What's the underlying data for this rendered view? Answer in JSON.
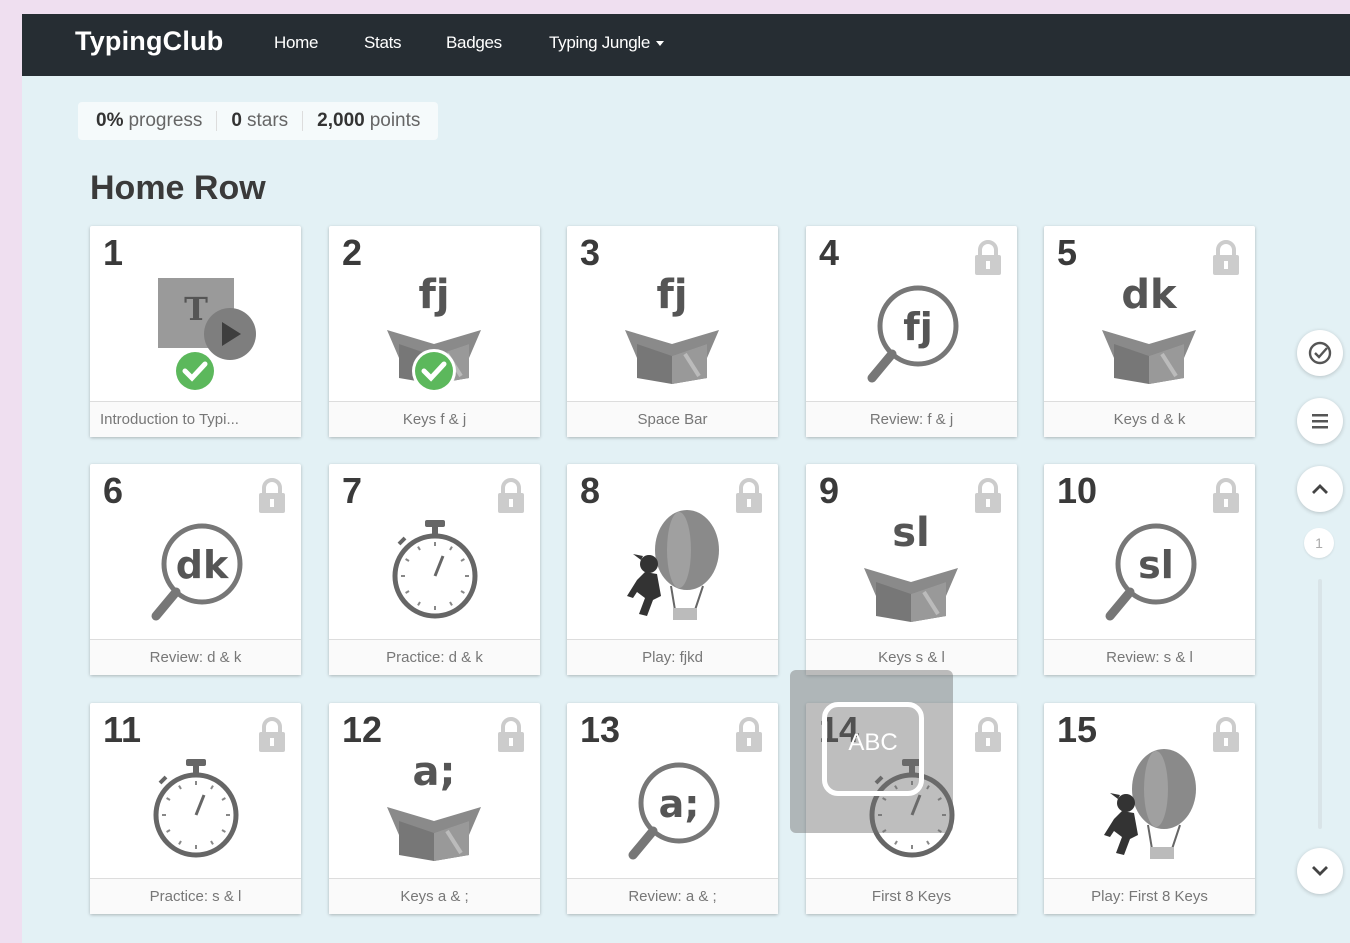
{
  "nav": {
    "brand": "TypingClub",
    "links": [
      "Home",
      "Stats",
      "Badges",
      "Typing Jungle"
    ]
  },
  "stats": {
    "progress_value": "0%",
    "progress_label": "progress",
    "stars_value": "0",
    "stars_label": "stars",
    "points_value": "2,000",
    "points_label": "points"
  },
  "section": {
    "title": "Home Row"
  },
  "lessons": [
    {
      "num": "1",
      "label": "Introduction to Typi...",
      "icon": "video-intro-icon",
      "locked": false,
      "completed": true
    },
    {
      "num": "2",
      "label": "Keys f & j",
      "icon": "box-icon",
      "glyph": "fj",
      "locked": false,
      "completed": true
    },
    {
      "num": "3",
      "label": "Space Bar",
      "icon": "box-icon",
      "glyph": "fj",
      "locked": false,
      "completed": false
    },
    {
      "num": "4",
      "label": "Review: f & j",
      "icon": "magnifier-icon",
      "glyph": "fj",
      "locked": true,
      "completed": false
    },
    {
      "num": "5",
      "label": "Keys d & k",
      "icon": "box-icon",
      "glyph": "dk",
      "locked": true,
      "completed": false
    },
    {
      "num": "6",
      "label": "Review: d & k",
      "icon": "magnifier-icon",
      "glyph": "dk",
      "locked": true,
      "completed": false
    },
    {
      "num": "7",
      "label": "Practice: d & k",
      "icon": "stopwatch-icon",
      "locked": true,
      "completed": false
    },
    {
      "num": "8",
      "label": "Play: fjkd",
      "icon": "balloon-game-icon",
      "locked": true,
      "completed": false
    },
    {
      "num": "9",
      "label": "Keys s & l",
      "icon": "box-icon",
      "glyph": "sl",
      "locked": true,
      "completed": false
    },
    {
      "num": "10",
      "label": "Review: s & l",
      "icon": "magnifier-icon",
      "glyph": "sl",
      "locked": true,
      "completed": false
    },
    {
      "num": "11",
      "label": "Practice: s & l",
      "icon": "stopwatch-icon",
      "locked": true,
      "completed": false
    },
    {
      "num": "12",
      "label": "Keys a & ;",
      "icon": "box-icon",
      "glyph": "a;",
      "locked": true,
      "completed": false
    },
    {
      "num": "13",
      "label": "Review: a & ;",
      "icon": "magnifier-icon",
      "glyph": "a;",
      "locked": true,
      "completed": false
    },
    {
      "num": "14",
      "label": "First 8 Keys",
      "icon": "stopwatch-icon",
      "locked": true,
      "completed": false
    },
    {
      "num": "15",
      "label": "Play: First 8 Keys",
      "icon": "balloon-game-icon",
      "locked": true,
      "completed": false
    }
  ],
  "sidebar": {
    "page_number": "1"
  },
  "overlay": {
    "text": "ABC"
  },
  "colors": {
    "nav_bg": "#262d33",
    "page_bg": "#e3f1f5",
    "check_green": "#5cb85c",
    "icon_gray": "#8a8a8a"
  }
}
